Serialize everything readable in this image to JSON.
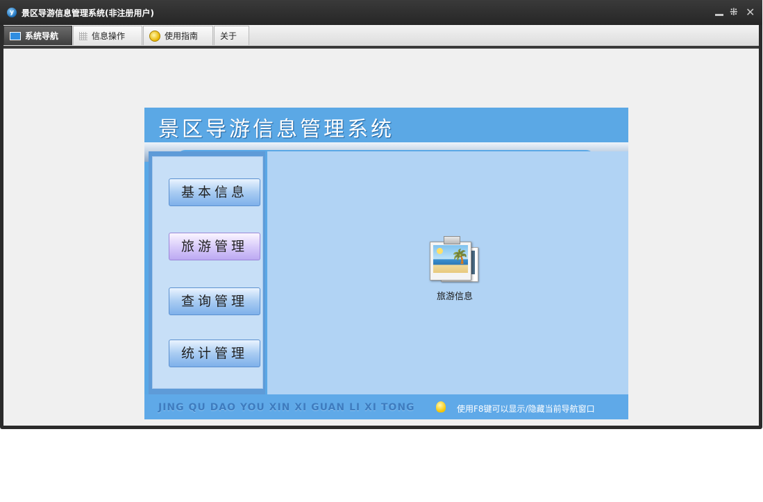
{
  "window": {
    "title": "景区导游信息管理系统(非注册用户)",
    "logo_letter": "y"
  },
  "tabs": [
    {
      "label": "系统导航",
      "icon": "monitor-icon",
      "active": true
    },
    {
      "label": "信息操作",
      "icon": "grid-icon",
      "active": false
    },
    {
      "label": "使用指南",
      "icon": "bulb-icon",
      "active": false
    },
    {
      "label": "关于",
      "icon": "",
      "active": false
    }
  ],
  "panel": {
    "title": "景区导游信息管理系统",
    "nav": [
      {
        "label": "基本信息"
      },
      {
        "label": "旅游管理"
      },
      {
        "label": "查询管理"
      },
      {
        "label": "统计管理"
      }
    ],
    "item": {
      "label": "旅游信息",
      "icon": "beach-photo-icon"
    },
    "footer_pinyin": "JING QU DAO YOU XIN XI GUAN LI XI TONG",
    "footer_hint": "使用F8键可以显示/隐藏当前导航窗口"
  },
  "colors": {
    "panel_blue": "#5aa8e6",
    "main_area": "#b1d3f4",
    "sidebar": "#c7dff7",
    "selected_nav": "#d9ccfa"
  }
}
